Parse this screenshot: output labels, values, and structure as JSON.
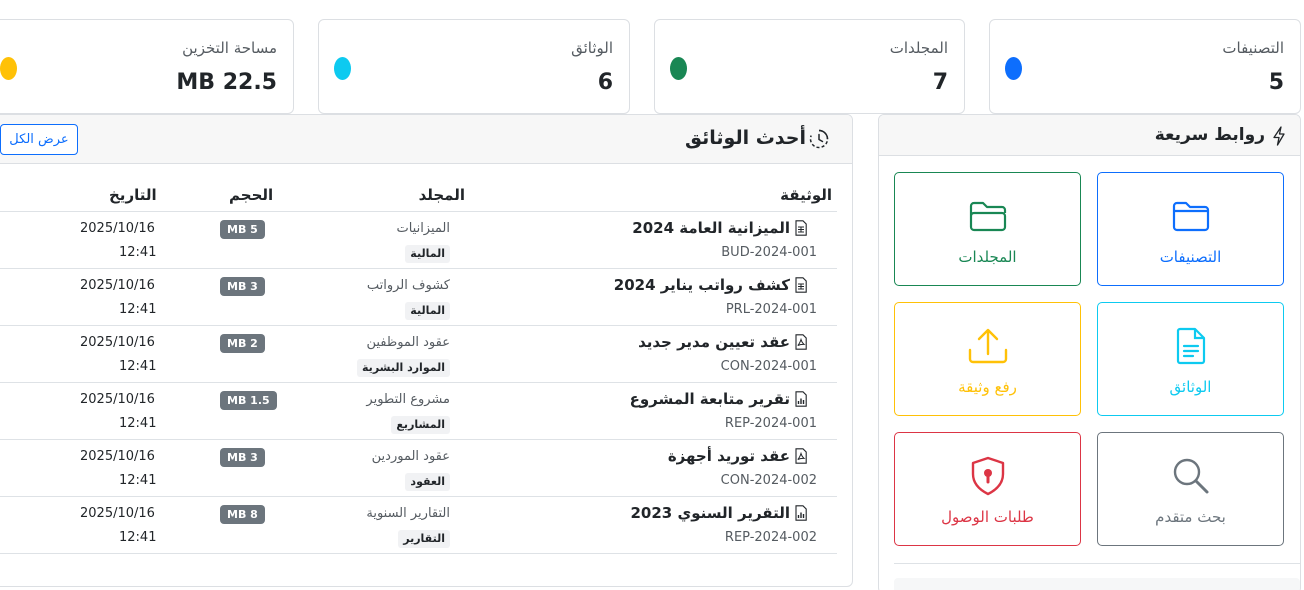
{
  "stats": [
    {
      "label": "التصنيفات",
      "value": "5",
      "color": "#0d6efd"
    },
    {
      "label": "المجلدات",
      "value": "7",
      "color": "#198754"
    },
    {
      "label": "الوثائق",
      "value": "6",
      "color": "#0dcaf0"
    },
    {
      "label": "مساحة التخزين",
      "value": "MB 22.5",
      "color": "#ffc107"
    }
  ],
  "recent": {
    "title": "أحدث الوثائق",
    "title_icon": "clock-history-icon",
    "view_all": "عرض الكل",
    "headers": {
      "document": "الوثيقة",
      "folder": "المجلد",
      "size": "الحجم",
      "date": "التاريخ"
    },
    "rows": [
      {
        "name": "الميزانية العامة 2024",
        "icon": "spreadsheet-file-icon",
        "code": "BUD-2024-001",
        "folder": "الميزانيات",
        "category": "المالية",
        "size": "MB 5",
        "date": "2025/10/16",
        "time": "12:41"
      },
      {
        "name": "كشف رواتب يناير 2024",
        "icon": "spreadsheet-file-icon",
        "code": "PRL-2024-001",
        "folder": "كشوف الرواتب",
        "category": "المالية",
        "size": "MB 3",
        "date": "2025/10/16",
        "time": "12:41"
      },
      {
        "name": "عقد تعيين مدير جديد",
        "icon": "pdf-file-icon",
        "code": "CON-2024-001",
        "folder": "عقود الموظفين",
        "category": "الموارد البشرية",
        "size": "MB 2",
        "date": "2025/10/16",
        "time": "12:41"
      },
      {
        "name": "تقرير متابعة المشروع",
        "icon": "chart-file-icon",
        "code": "REP-2024-001",
        "folder": "مشروع التطوير",
        "category": "المشاريع",
        "size": "MB 1.5",
        "date": "2025/10/16",
        "time": "12:41"
      },
      {
        "name": "عقد توريد أجهزة",
        "icon": "pdf-file-icon",
        "code": "CON-2024-002",
        "folder": "عقود الموردين",
        "category": "العقود",
        "size": "MB 3",
        "date": "2025/10/16",
        "time": "12:41"
      },
      {
        "name": "التقرير السنوي 2023",
        "icon": "chart-file-icon",
        "code": "REP-2024-002",
        "folder": "التقارير السنوية",
        "category": "التقارير",
        "size": "MB 8",
        "date": "2025/10/16",
        "time": "12:41"
      }
    ]
  },
  "quick_links": {
    "title": "روابط سريعة",
    "title_icon": "lightning-icon",
    "items": [
      {
        "label": "التصنيفات",
        "icon": "folder-icon",
        "color": "#0d6efd"
      },
      {
        "label": "المجلدات",
        "icon": "folder-open-icon",
        "color": "#198754"
      },
      {
        "label": "الوثائق",
        "icon": "document-icon",
        "color": "#0dcaf0"
      },
      {
        "label": "رفع وثيقة",
        "icon": "upload-icon",
        "color": "#ffc107"
      },
      {
        "label": "بحث متقدم",
        "icon": "search-icon",
        "color": "#6c757d"
      },
      {
        "label": "طلبات الوصول",
        "icon": "shield-lock-icon",
        "color": "#dc3545"
      }
    ]
  }
}
